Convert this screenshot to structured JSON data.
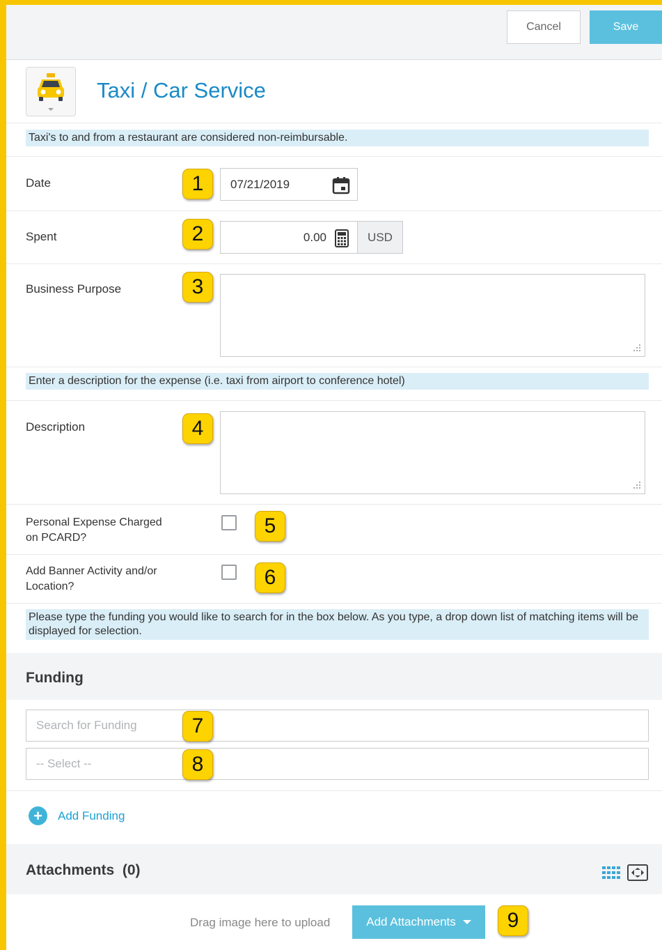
{
  "toolbar": {
    "cancel_label": "Cancel",
    "save_label": "Save"
  },
  "header": {
    "title": "Taxi / Car Service",
    "icon": "taxi-icon"
  },
  "notices": {
    "restaurant": "Taxi's to and from a restaurant are considered non-reimbursable.",
    "description_hint": "Enter a description for the expense (i.e. taxi from airport to conference hotel)",
    "funding_hint": "Please type the funding you would like to search for in the box below. As you type, a drop down list of matching items will be displayed for selection."
  },
  "fields": {
    "date": {
      "label": "Date",
      "value": "07/21/2019"
    },
    "spent": {
      "label": "Spent",
      "value": "0.00",
      "currency": "USD"
    },
    "business_purpose": {
      "label": "Business Purpose",
      "value": ""
    },
    "description": {
      "label": "Description",
      "value": ""
    },
    "personal_expense": {
      "label_line1": "Personal Expense Charged",
      "label_line2": "on PCARD?",
      "checked": false
    },
    "banner_activity": {
      "label_line1": "Add Banner Activity and/or",
      "label_line2": "Location?",
      "checked": false
    }
  },
  "funding": {
    "title": "Funding",
    "search_placeholder": "Search for Funding",
    "select_placeholder": "-- Select --",
    "add_label": "Add Funding"
  },
  "attachments": {
    "title": "Attachments",
    "count": "(0)",
    "drag_text": "Drag image here to upload",
    "add_label": "Add Attachments"
  },
  "badges": [
    "1",
    "2",
    "3",
    "4",
    "5",
    "6",
    "7",
    "8",
    "9"
  ],
  "colors": {
    "accent": "#5bc0de",
    "title_blue": "#1a8ac6",
    "frame_yellow": "#f7c600",
    "badge_yellow": "#fdd300",
    "notice_bg": "#daeef7"
  }
}
